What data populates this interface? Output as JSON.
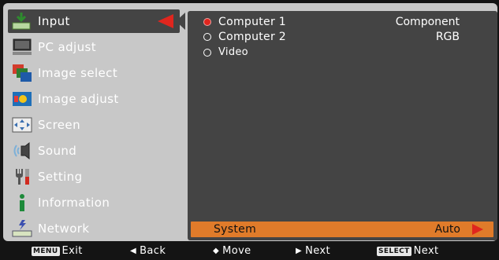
{
  "menu": {
    "items": [
      {
        "label": "Input",
        "icon": "input-icon",
        "active": true
      },
      {
        "label": "PC adjust",
        "icon": "pc-adjust-icon",
        "active": false
      },
      {
        "label": "Image select",
        "icon": "image-select-icon",
        "active": false
      },
      {
        "label": "Image adjust",
        "icon": "image-adjust-icon",
        "active": false
      },
      {
        "label": "Screen",
        "icon": "screen-icon",
        "active": false
      },
      {
        "label": "Sound",
        "icon": "sound-icon",
        "active": false
      },
      {
        "label": "Setting",
        "icon": "setting-icon",
        "active": false
      },
      {
        "label": "Information",
        "icon": "information-icon",
        "active": false
      },
      {
        "label": "Network",
        "icon": "network-icon",
        "active": false
      }
    ]
  },
  "content": {
    "options": [
      {
        "label": "Computer 1",
        "value": "Component",
        "selected": true
      },
      {
        "label": "Computer 2",
        "value": "RGB",
        "selected": false
      },
      {
        "label": "Video",
        "value": "",
        "selected": false
      }
    ],
    "system": {
      "label": "System",
      "value": "Auto"
    }
  },
  "footer": {
    "exit": {
      "key": "MENU",
      "label": "Exit"
    },
    "back": {
      "label": "Back"
    },
    "move": {
      "label": "Move"
    },
    "next": {
      "label": "Next"
    },
    "select_next": {
      "key": "SELECT",
      "label": "Next"
    }
  },
  "colors": {
    "accent": "#e0261e",
    "highlight": "#e07b2a",
    "panel": "#c8c8c8",
    "content": "#444444"
  }
}
